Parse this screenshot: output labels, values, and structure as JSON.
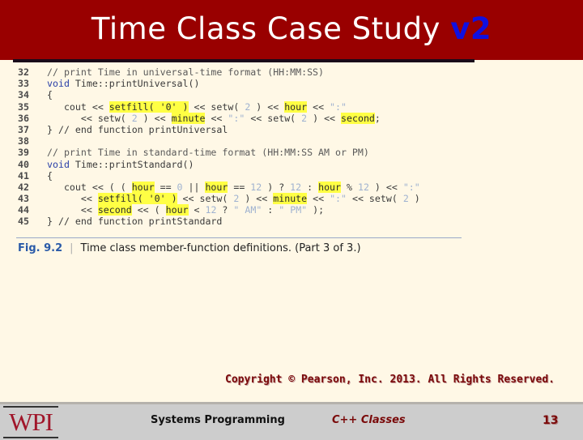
{
  "slide": {
    "title": "Time Class Case Study ",
    "title_version": "v2",
    "colors": {
      "title_bar": "#990000",
      "title_text": "#ffffff",
      "version_text": "#1010e0",
      "background": "#fff8e6",
      "highlight": "#ffff44",
      "footer": "#cdcdcd"
    }
  },
  "code": {
    "lines": [
      {
        "num": "32",
        "segments": [
          {
            "t": "// print Time in universal-time format (HH:MM:SS)",
            "c": "cm"
          }
        ]
      },
      {
        "num": "33",
        "segments": [
          {
            "t": "void",
            "c": "kw"
          },
          {
            "t": " Time::printUniversal()",
            "c": ""
          }
        ]
      },
      {
        "num": "34",
        "segments": [
          {
            "t": "{",
            "c": ""
          }
        ]
      },
      {
        "num": "35",
        "segments": [
          {
            "t": "   cout << ",
            "c": ""
          },
          {
            "t": "setfill( '0' )",
            "c": "hl"
          },
          {
            "t": " << setw( ",
            "c": ""
          },
          {
            "t": "2",
            "c": "lit"
          },
          {
            "t": " ) << ",
            "c": ""
          },
          {
            "t": "hour",
            "c": "hl"
          },
          {
            "t": " << ",
            "c": ""
          },
          {
            "t": "\":\"",
            "c": "lit"
          }
        ]
      },
      {
        "num": "36",
        "segments": [
          {
            "t": "      << setw( ",
            "c": ""
          },
          {
            "t": "2",
            "c": "lit"
          },
          {
            "t": " ) << ",
            "c": ""
          },
          {
            "t": "minute",
            "c": "hl"
          },
          {
            "t": " << ",
            "c": ""
          },
          {
            "t": "\":\"",
            "c": "lit"
          },
          {
            "t": " << setw( ",
            "c": ""
          },
          {
            "t": "2",
            "c": "lit"
          },
          {
            "t": " ) << ",
            "c": ""
          },
          {
            "t": "second",
            "c": "hl"
          },
          {
            "t": ";",
            "c": ""
          }
        ]
      },
      {
        "num": "37",
        "segments": [
          {
            "t": "} // end function printUniversal",
            "c": ""
          }
        ]
      },
      {
        "num": "38",
        "segments": [
          {
            "t": "",
            "c": ""
          }
        ]
      },
      {
        "num": "39",
        "segments": [
          {
            "t": "// print Time in standard-time format (HH:MM:SS AM or PM)",
            "c": "cm"
          }
        ]
      },
      {
        "num": "40",
        "segments": [
          {
            "t": "void",
            "c": "kw"
          },
          {
            "t": " Time::printStandard()",
            "c": ""
          }
        ]
      },
      {
        "num": "41",
        "segments": [
          {
            "t": "{",
            "c": ""
          }
        ]
      },
      {
        "num": "42",
        "segments": [
          {
            "t": "   cout << ( ( ",
            "c": ""
          },
          {
            "t": "hour",
            "c": "hl"
          },
          {
            "t": " == ",
            "c": ""
          },
          {
            "t": "0",
            "c": "lit"
          },
          {
            "t": " || ",
            "c": ""
          },
          {
            "t": "hour",
            "c": "hl"
          },
          {
            "t": " == ",
            "c": ""
          },
          {
            "t": "12",
            "c": "lit"
          },
          {
            "t": " ) ? ",
            "c": ""
          },
          {
            "t": "12",
            "c": "lit"
          },
          {
            "t": " : ",
            "c": ""
          },
          {
            "t": "hour",
            "c": "hl"
          },
          {
            "t": " % ",
            "c": ""
          },
          {
            "t": "12",
            "c": "lit"
          },
          {
            "t": " ) << ",
            "c": ""
          },
          {
            "t": "\":\"",
            "c": "lit"
          }
        ]
      },
      {
        "num": "43",
        "segments": [
          {
            "t": "      << ",
            "c": ""
          },
          {
            "t": "setfill( '0' )",
            "c": "hl"
          },
          {
            "t": " << setw( ",
            "c": ""
          },
          {
            "t": "2",
            "c": "lit"
          },
          {
            "t": " ) << ",
            "c": ""
          },
          {
            "t": "minute",
            "c": "hl"
          },
          {
            "t": " << ",
            "c": ""
          },
          {
            "t": "\":\"",
            "c": "lit"
          },
          {
            "t": " << setw( ",
            "c": ""
          },
          {
            "t": "2",
            "c": "lit"
          },
          {
            "t": " )",
            "c": ""
          }
        ]
      },
      {
        "num": "44",
        "segments": [
          {
            "t": "      << ",
            "c": ""
          },
          {
            "t": "second",
            "c": "hl"
          },
          {
            "t": " << ( ",
            "c": ""
          },
          {
            "t": "hour",
            "c": "hl"
          },
          {
            "t": " < ",
            "c": ""
          },
          {
            "t": "12",
            "c": "lit"
          },
          {
            "t": " ? ",
            "c": ""
          },
          {
            "t": "\" AM\"",
            "c": "lit"
          },
          {
            "t": " : ",
            "c": ""
          },
          {
            "t": "\" PM\"",
            "c": "lit"
          },
          {
            "t": " );",
            "c": ""
          }
        ]
      },
      {
        "num": "45",
        "segments": [
          {
            "t": "} // end function printStandard",
            "c": ""
          }
        ]
      }
    ]
  },
  "figure": {
    "number": "Fig. 9.2",
    "separator": "|",
    "caption": "Time class member-function definitions. (Part 3 of 3.)"
  },
  "copyright": "Copyright © Pearson, Inc. 2013. All Rights Reserved.",
  "footer": {
    "logo": "WPI",
    "course": "Systems Programming",
    "topic": "C++ Classes",
    "page": "13"
  }
}
